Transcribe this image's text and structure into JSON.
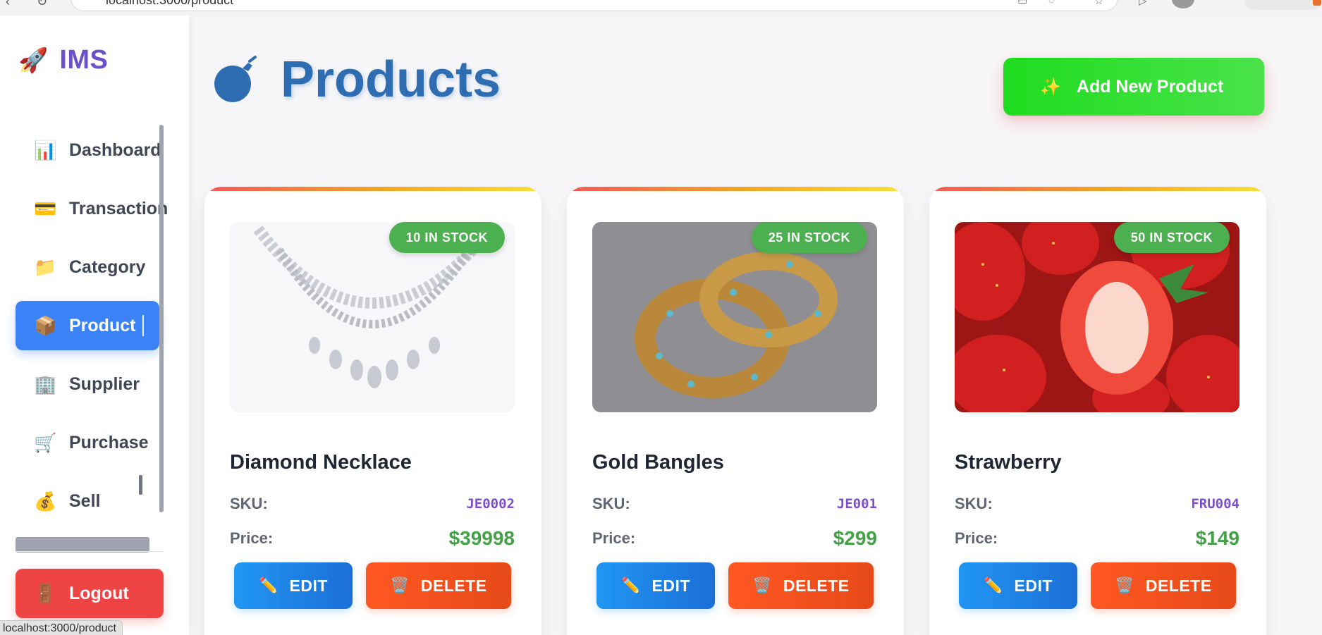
{
  "browser": {
    "url": "localhost:3000/product",
    "status_url": "localhost:3000/product"
  },
  "sidebar": {
    "brand": {
      "icon": "rocket-icon",
      "glyph": "🚀",
      "name": "IMS"
    },
    "items": [
      {
        "label": "Dashboard",
        "icon": "bar-chart-icon",
        "glyph": "📊",
        "active": false
      },
      {
        "label": "Transactions",
        "icon": "credit-card-icon",
        "glyph": "💳",
        "active": false
      },
      {
        "label": "Category",
        "icon": "folder-icon",
        "glyph": "📁",
        "active": false
      },
      {
        "label": "Product",
        "icon": "package-icon",
        "glyph": "📦",
        "active": true
      },
      {
        "label": "Supplier",
        "icon": "building-icon",
        "glyph": "🏢",
        "active": false
      },
      {
        "label": "Purchase",
        "icon": "shopping-cart-icon",
        "glyph": "🛒",
        "active": false
      },
      {
        "label": "Sell",
        "icon": "money-bag-icon",
        "glyph": "💰",
        "active": false
      }
    ],
    "logout": {
      "label": "Logout",
      "icon": "door-icon",
      "glyph": "🚪"
    },
    "active_color": "#3b82f6",
    "logout_color": "#ef4444"
  },
  "header": {
    "title": "Products",
    "icon": "bomb-icon",
    "add_button": {
      "label": "Add New Product",
      "icon": "sparkles-icon",
      "glyph": "✨"
    }
  },
  "products": [
    {
      "name": "Diamond Necklace",
      "stock_badge": "10 IN STOCK",
      "sku_label": "SKU:",
      "sku": "JE0002",
      "price_label": "Price:",
      "price": "$39998",
      "image": "diamond-necklace-image"
    },
    {
      "name": "Gold Bangles",
      "stock_badge": "25 IN STOCK",
      "sku_label": "SKU:",
      "sku": "JE001",
      "price_label": "Price:",
      "price": "$299",
      "image": "gold-bangles-image"
    },
    {
      "name": "Strawberry",
      "stock_badge": "50 IN STOCK",
      "sku_label": "SKU:",
      "sku": "FRU004",
      "price_label": "Price:",
      "price": "$149",
      "image": "strawberry-image"
    }
  ],
  "actions": {
    "edit_label": "EDIT",
    "edit_icon": "pencil-icon",
    "edit_glyph": "✏️",
    "delete_label": "DELETE",
    "delete_icon": "wastebasket-icon",
    "delete_glyph": "🗑️"
  },
  "colors": {
    "title": "#2f6db3",
    "brand": "#6a51c7",
    "stock_badge": "#4caf50",
    "price": "#43a047",
    "sku": "#7b4fcf",
    "edit": "#2196f3",
    "delete": "#ff5722",
    "add": "#22dc22"
  }
}
